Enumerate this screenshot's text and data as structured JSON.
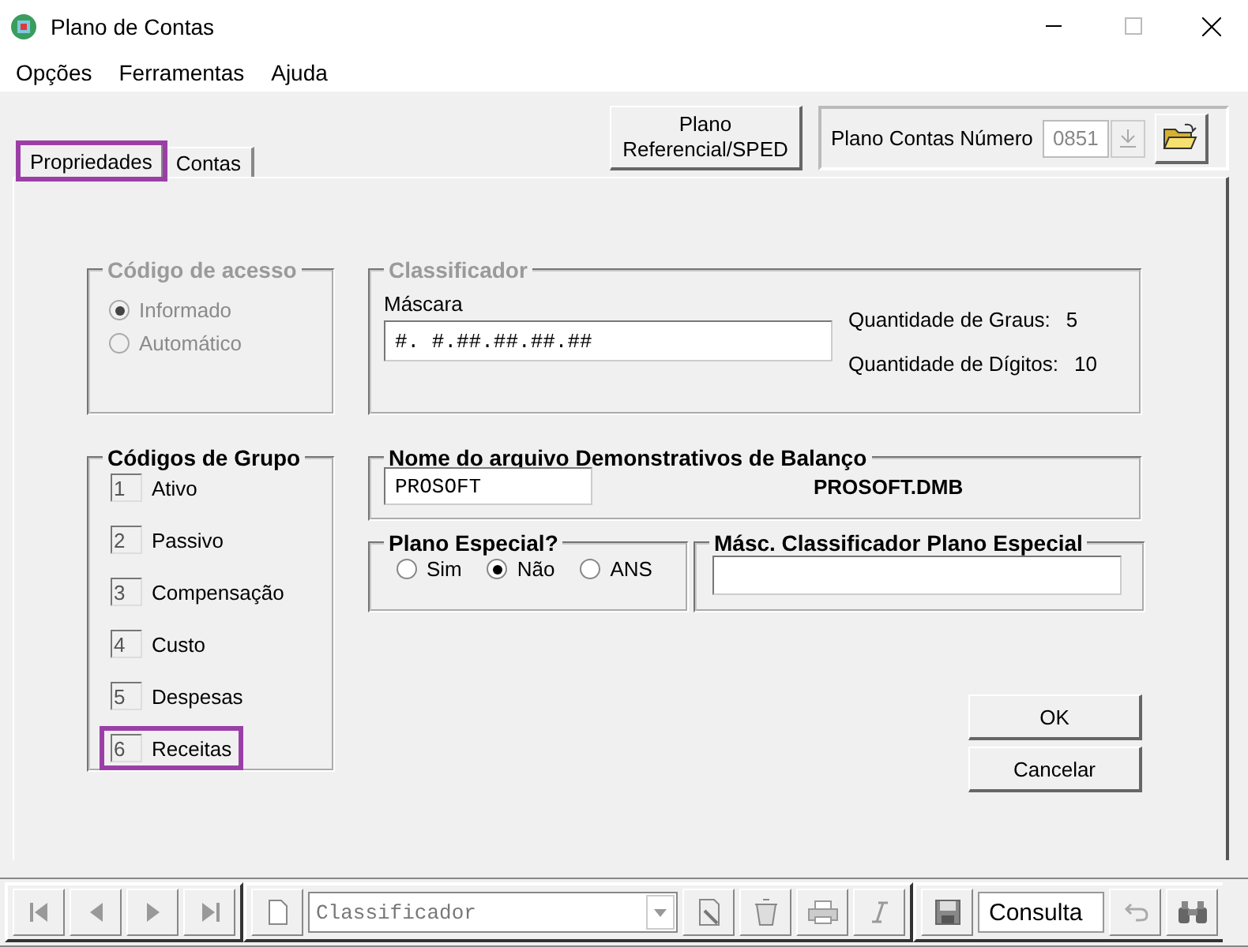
{
  "window": {
    "title": "Plano de Contas"
  },
  "menu": [
    {
      "label": "Opções"
    },
    {
      "label": "Ferramentas"
    },
    {
      "label": "Ajuda"
    }
  ],
  "toolbar": {
    "ref_button": "Plano Referencial/SPED",
    "plan_label": "Plano Contas Número",
    "plan_value": "0851"
  },
  "tabs": [
    {
      "label": "Propriedades",
      "selected": true,
      "highlighted": true
    },
    {
      "label": "Contas",
      "selected": false,
      "highlighted": false
    }
  ],
  "access_code": {
    "title": "Código de acesso",
    "disabled": true,
    "options": [
      {
        "label": "Informado",
        "selected": true
      },
      {
        "label": "Automático",
        "selected": false
      }
    ]
  },
  "classifier": {
    "title": "Classificador",
    "mask_label": "Máscara",
    "mask_value": "#. #.##.##.##.##",
    "stats": [
      {
        "label": "Quantidade de Graus:",
        "value": "5"
      },
      {
        "label": "Quantidade de Dígitos:",
        "value": "10"
      }
    ]
  },
  "group_codes": {
    "title": "Códigos de Grupo",
    "items": [
      {
        "code": "1",
        "label": "Ativo",
        "highlighted": false
      },
      {
        "code": "2",
        "label": "Passivo",
        "highlighted": false
      },
      {
        "code": "3",
        "label": "Compensação",
        "highlighted": false
      },
      {
        "code": "4",
        "label": "Custo",
        "highlighted": false
      },
      {
        "code": "5",
        "label": "Despesas",
        "highlighted": false
      },
      {
        "code": "6",
        "label": "Receitas",
        "highlighted": true
      }
    ]
  },
  "balance_file": {
    "title": "Nome do arquivo Demonstrativos de Balanço",
    "value": "PROSOFT",
    "file": "PROSOFT.DMB"
  },
  "special_plan": {
    "title": "Plano Especial?",
    "options": [
      {
        "label": "Sim",
        "selected": false
      },
      {
        "label": "Não",
        "selected": true
      },
      {
        "label": "ANS",
        "selected": false
      }
    ]
  },
  "special_mask": {
    "title": "Másc. Classificador Plano Especial"
  },
  "buttons": [
    "OK",
    "Cancelar"
  ],
  "nav_bar": {
    "combo": "Classificador",
    "mode": "Consulta"
  }
}
